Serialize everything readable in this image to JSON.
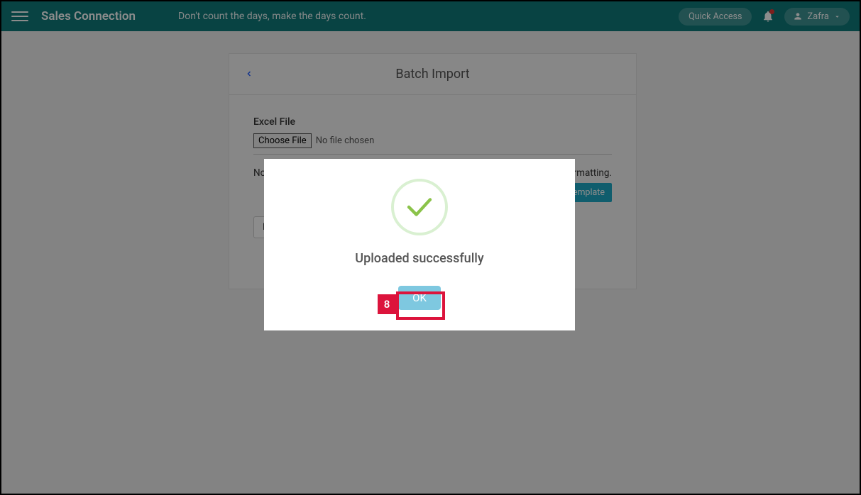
{
  "header": {
    "brand": "Sales Connection",
    "tagline": "Don't count the days, make the days count.",
    "quick_access": "Quick Access",
    "username": "Zafra"
  },
  "card": {
    "title": "Batch Import",
    "file_label": "Excel File",
    "choose_file": "Choose File",
    "file_status": "No file chosen",
    "note": "Note:",
    "note_suffix": "rmatting.",
    "template_btn": "el Template",
    "back_btn": "Back"
  },
  "modal": {
    "message": "Uploaded successfully",
    "ok": "OK"
  },
  "annotation": {
    "num": "8"
  }
}
